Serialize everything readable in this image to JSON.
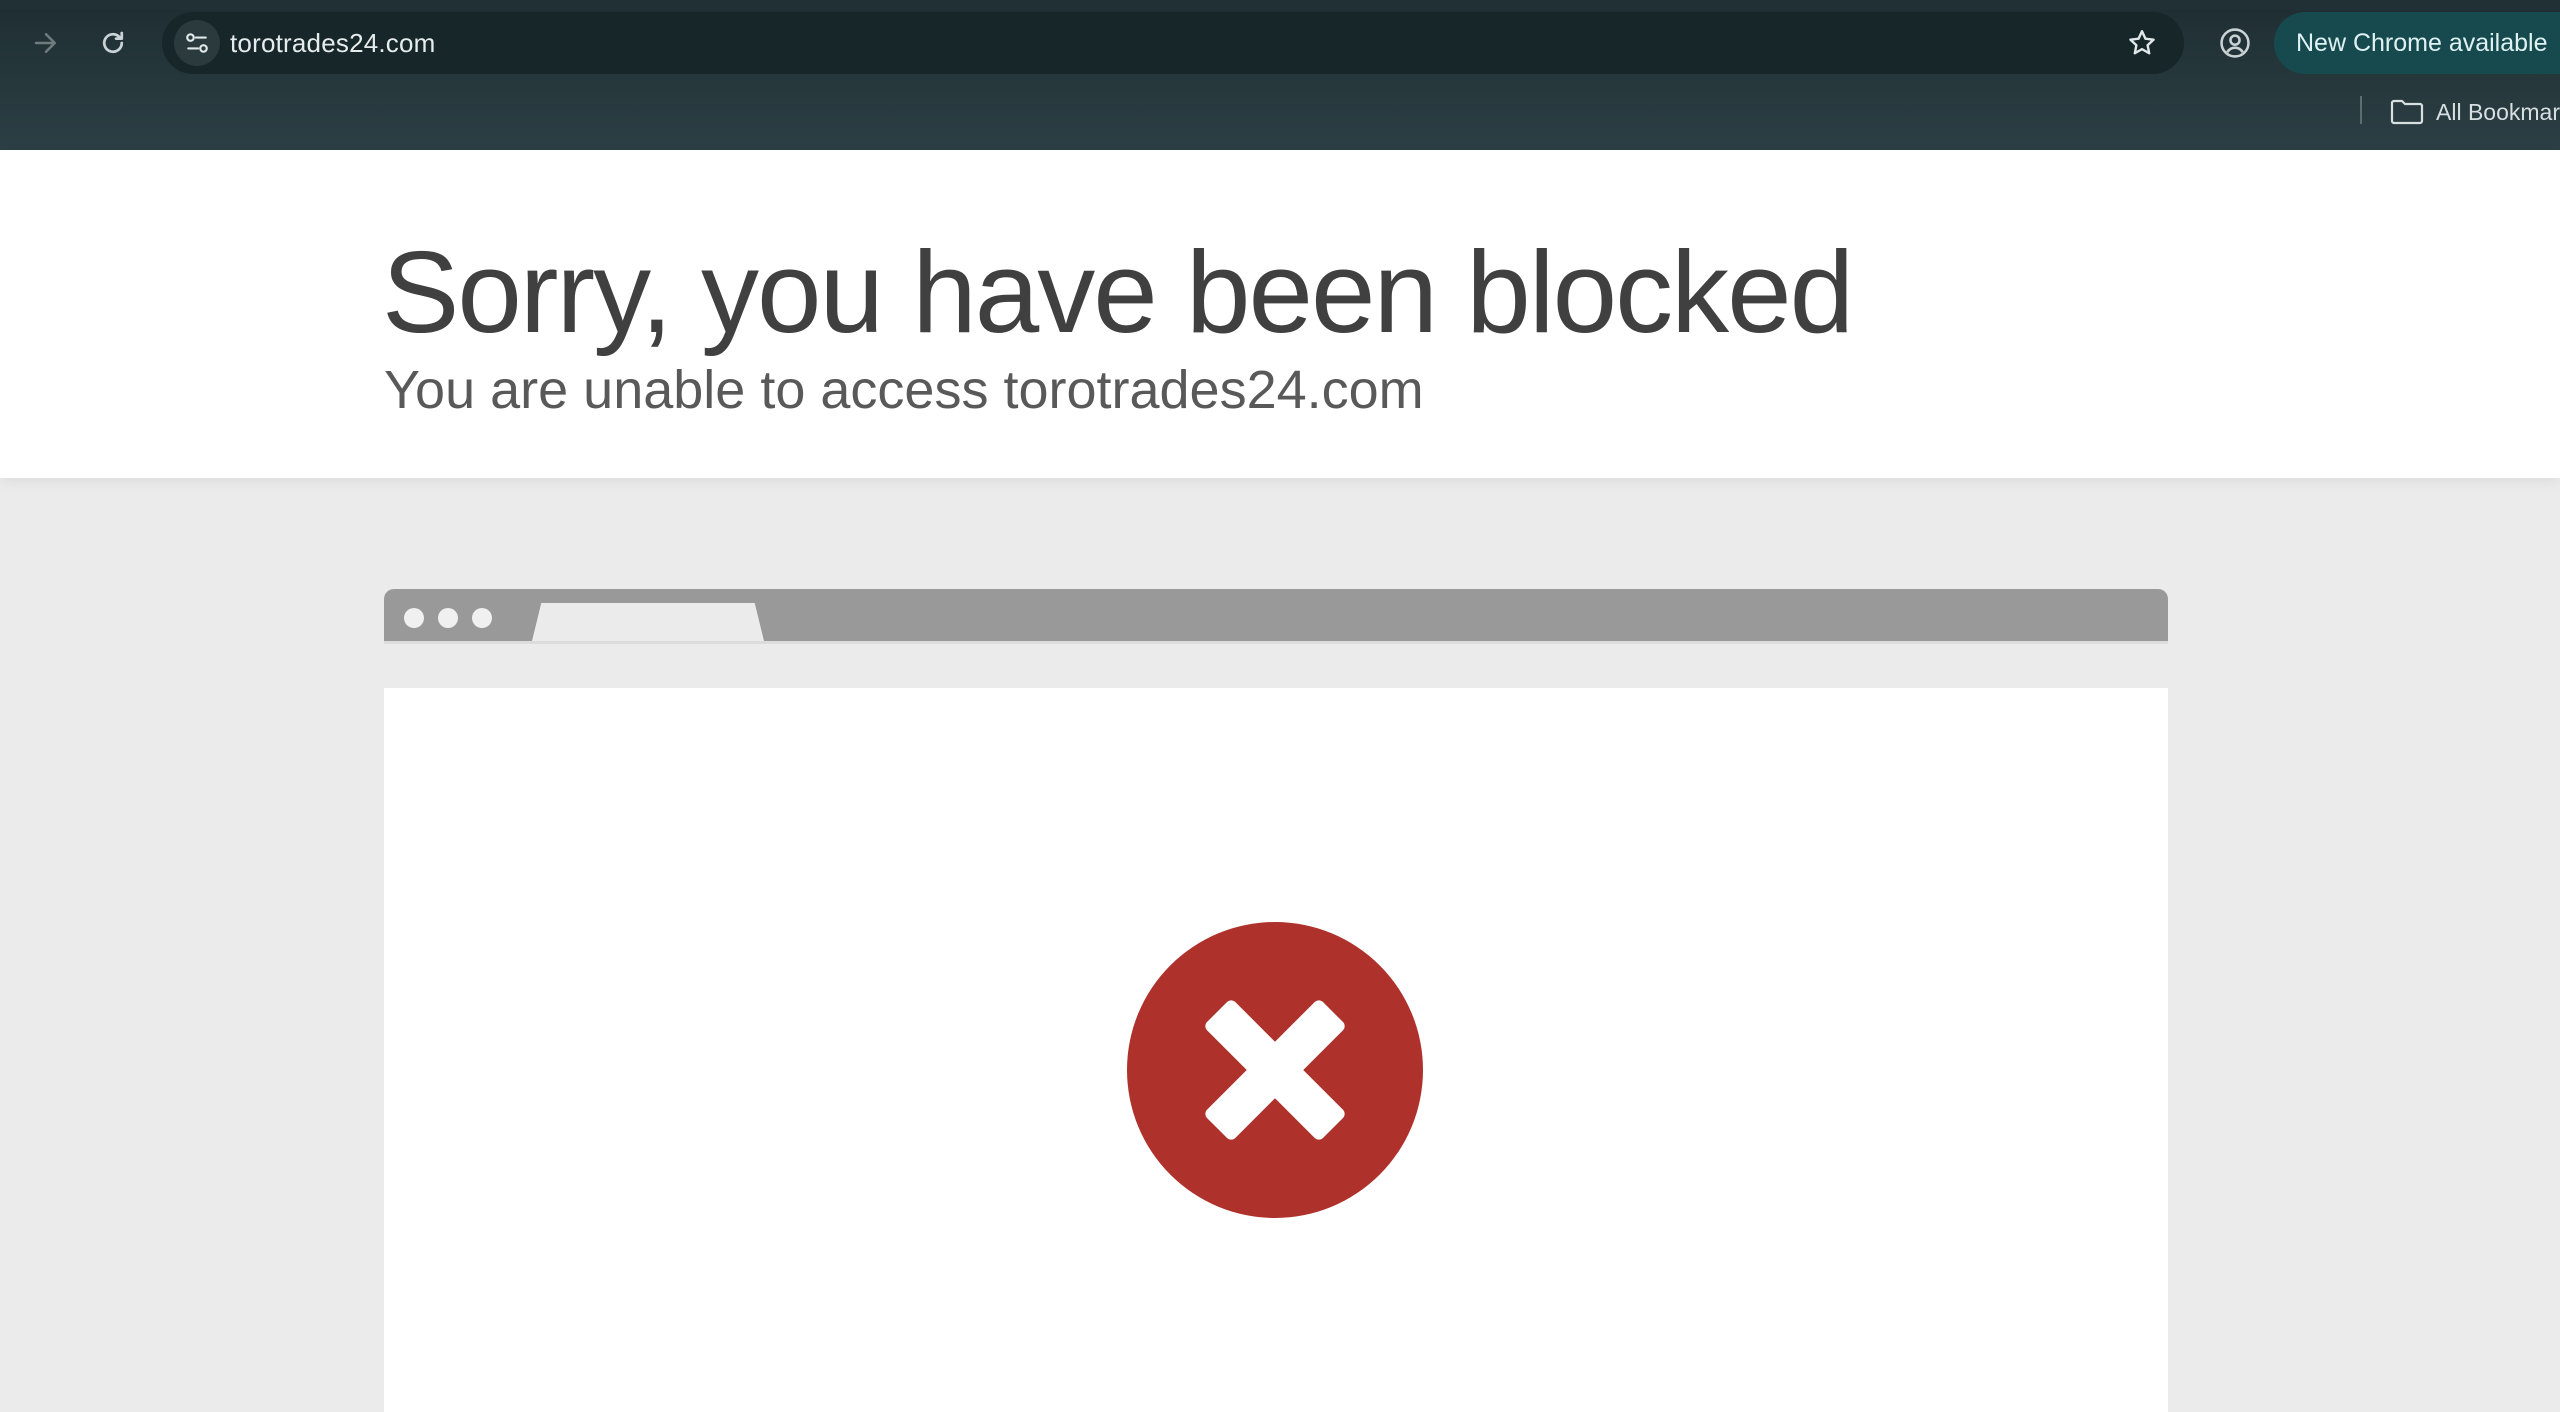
{
  "browser": {
    "url": "torotrades24.com",
    "update_label": "New Chrome available",
    "bookmarks_label": "All Bookmarks",
    "icons": {
      "forward": "arrow-right-icon",
      "reload": "reload-icon",
      "site_info": "tune-icon",
      "bookmark_star": "star-icon",
      "profile": "account-circle-icon",
      "folder": "folder-icon"
    }
  },
  "page": {
    "headline": "Sorry, you have been blocked",
    "subline": "You are unable to access torotrades24.com",
    "error_icon": "x-circle-icon",
    "colors": {
      "error_red": "#af312b",
      "heading_text": "#404040",
      "mock_bar": "#999999"
    }
  }
}
